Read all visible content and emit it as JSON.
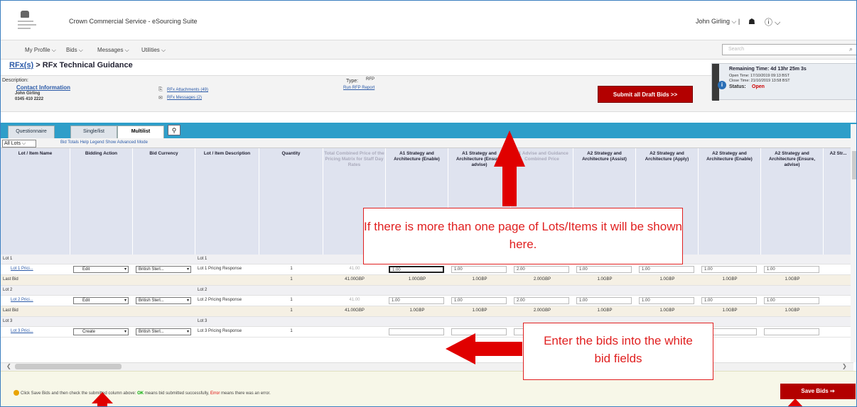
{
  "app": {
    "suite_title": "Crown Commercial Service - eSourcing Suite",
    "user": "John Girling ⌵ |"
  },
  "nav": {
    "items": [
      "My Profile ⌵",
      "Bids ⌵",
      "Messages ⌵",
      "Utilities ⌵"
    ],
    "search_placeholder": "Search"
  },
  "breadcrumb": {
    "link": "RFx(s)",
    "sep": " > ",
    "title": "RFx Technical Guidance"
  },
  "info": {
    "description_label": "Description:",
    "contact_link": "Contact Information",
    "contact_name": "John Girling",
    "contact_phone": "0345 410 2222",
    "attachments": "RFx Attachments (49)",
    "messages": "RFx Messages (2)",
    "type_label": "Type:",
    "type_value": "RFP",
    "report_link": "Run RFP Report",
    "submit_draft": "Submit all Draft Bids >>"
  },
  "timer": {
    "remaining": "Remaining Time: 4d 13hr 25m 3s",
    "open": "Open Time: 17/10/2019 09:13 BST",
    "close": "Close Time: 21/10/2019 13:58 BST",
    "status_label": "Status:",
    "status_value": "Open"
  },
  "tabs": [
    "Questionnaire",
    "Single/list",
    "Multilist"
  ],
  "lots_select": "All Lots ⌵",
  "lots_links": "Bid Totals  Help Legend  Show Advanced Mode",
  "columns": [
    "Lot / Item Name",
    "Bidding Action",
    "Bid Currency",
    "Lot / Item Description",
    "Quantity",
    "Total Combined Price of the Pricing Matrix for Staff Day Rates",
    "A1 Strategy and Architecture (Enable)",
    "A1 Strategy and Architecture (Ensure, advise)",
    "A1 Advise and Guidance Combined Price",
    "A2 Strategy and Architecture (Assist)",
    "A2 Strategy and Architecture (Apply)",
    "A2 Strategy and Architecture (Enable)",
    "A2 Strategy and Architecture (Ensure, advise)",
    "A2 Str..."
  ],
  "rows": [
    {
      "kind": "lot",
      "name": "Lot 1",
      "desc": "Lot 1"
    },
    {
      "kind": "bid",
      "name": "Lot 1 Prici...",
      "action": "Edit",
      "currency": "British Sterl...",
      "desc": "Lot 1 Pricing Response",
      "qty": "1",
      "total": "41.00",
      "vals": [
        "1.00",
        "1.00",
        "2.00",
        "1.00",
        "1.00",
        "1.00",
        "1.00"
      ]
    },
    {
      "kind": "last",
      "name": "Last Bid",
      "qty": "1",
      "total": "41.00GBP",
      "vals": [
        "1.00GBP",
        "1.0GBP",
        "2.00GBP",
        "1.0GBP",
        "1.0GBP",
        "1.0GBP",
        "1.0GBP"
      ]
    },
    {
      "kind": "lot",
      "name": "Lot 2",
      "desc": "Lot 2"
    },
    {
      "kind": "bid",
      "name": "Lot 2 Prici...",
      "action": "Edit",
      "currency": "British Sterl...",
      "desc": "Lot 2 Pricing Response",
      "qty": "1",
      "total": "41.00",
      "vals": [
        "1.00",
        "1.00",
        "2.00",
        "1.00",
        "1.00",
        "1.00",
        "1.00"
      ]
    },
    {
      "kind": "last",
      "name": "Last Bid",
      "qty": "1",
      "total": "41.00GBP",
      "vals": [
        "1.0GBP",
        "1.0GBP",
        "2.00GBP",
        "1.0GBP",
        "1.0GBP",
        "1.0GBP",
        "1.0GBP"
      ]
    },
    {
      "kind": "lot",
      "name": "Lot 3",
      "desc": "Lot 3"
    },
    {
      "kind": "bid",
      "name": "Lot 3 Prici...",
      "action": "Create",
      "currency": "British Sterl...",
      "desc": "Lot 3 Pricing Response",
      "qty": "1",
      "total": "",
      "vals": [
        "",
        "",
        "",
        "",
        "",
        "",
        ""
      ]
    }
  ],
  "footer": {
    "msg_a": "Click Save Bids and then check the submitted column above: ",
    "ok": "OK",
    "msg_b": " means bid submitted successfully, ",
    "err": "Error",
    "msg_c": " means there was an error.",
    "save": "Save Bids ⇒"
  },
  "callouts": {
    "pages": "If there is more than one page of Lots/Items it will be shown here.",
    "bids": "Enter the bids into the white bid fields"
  }
}
